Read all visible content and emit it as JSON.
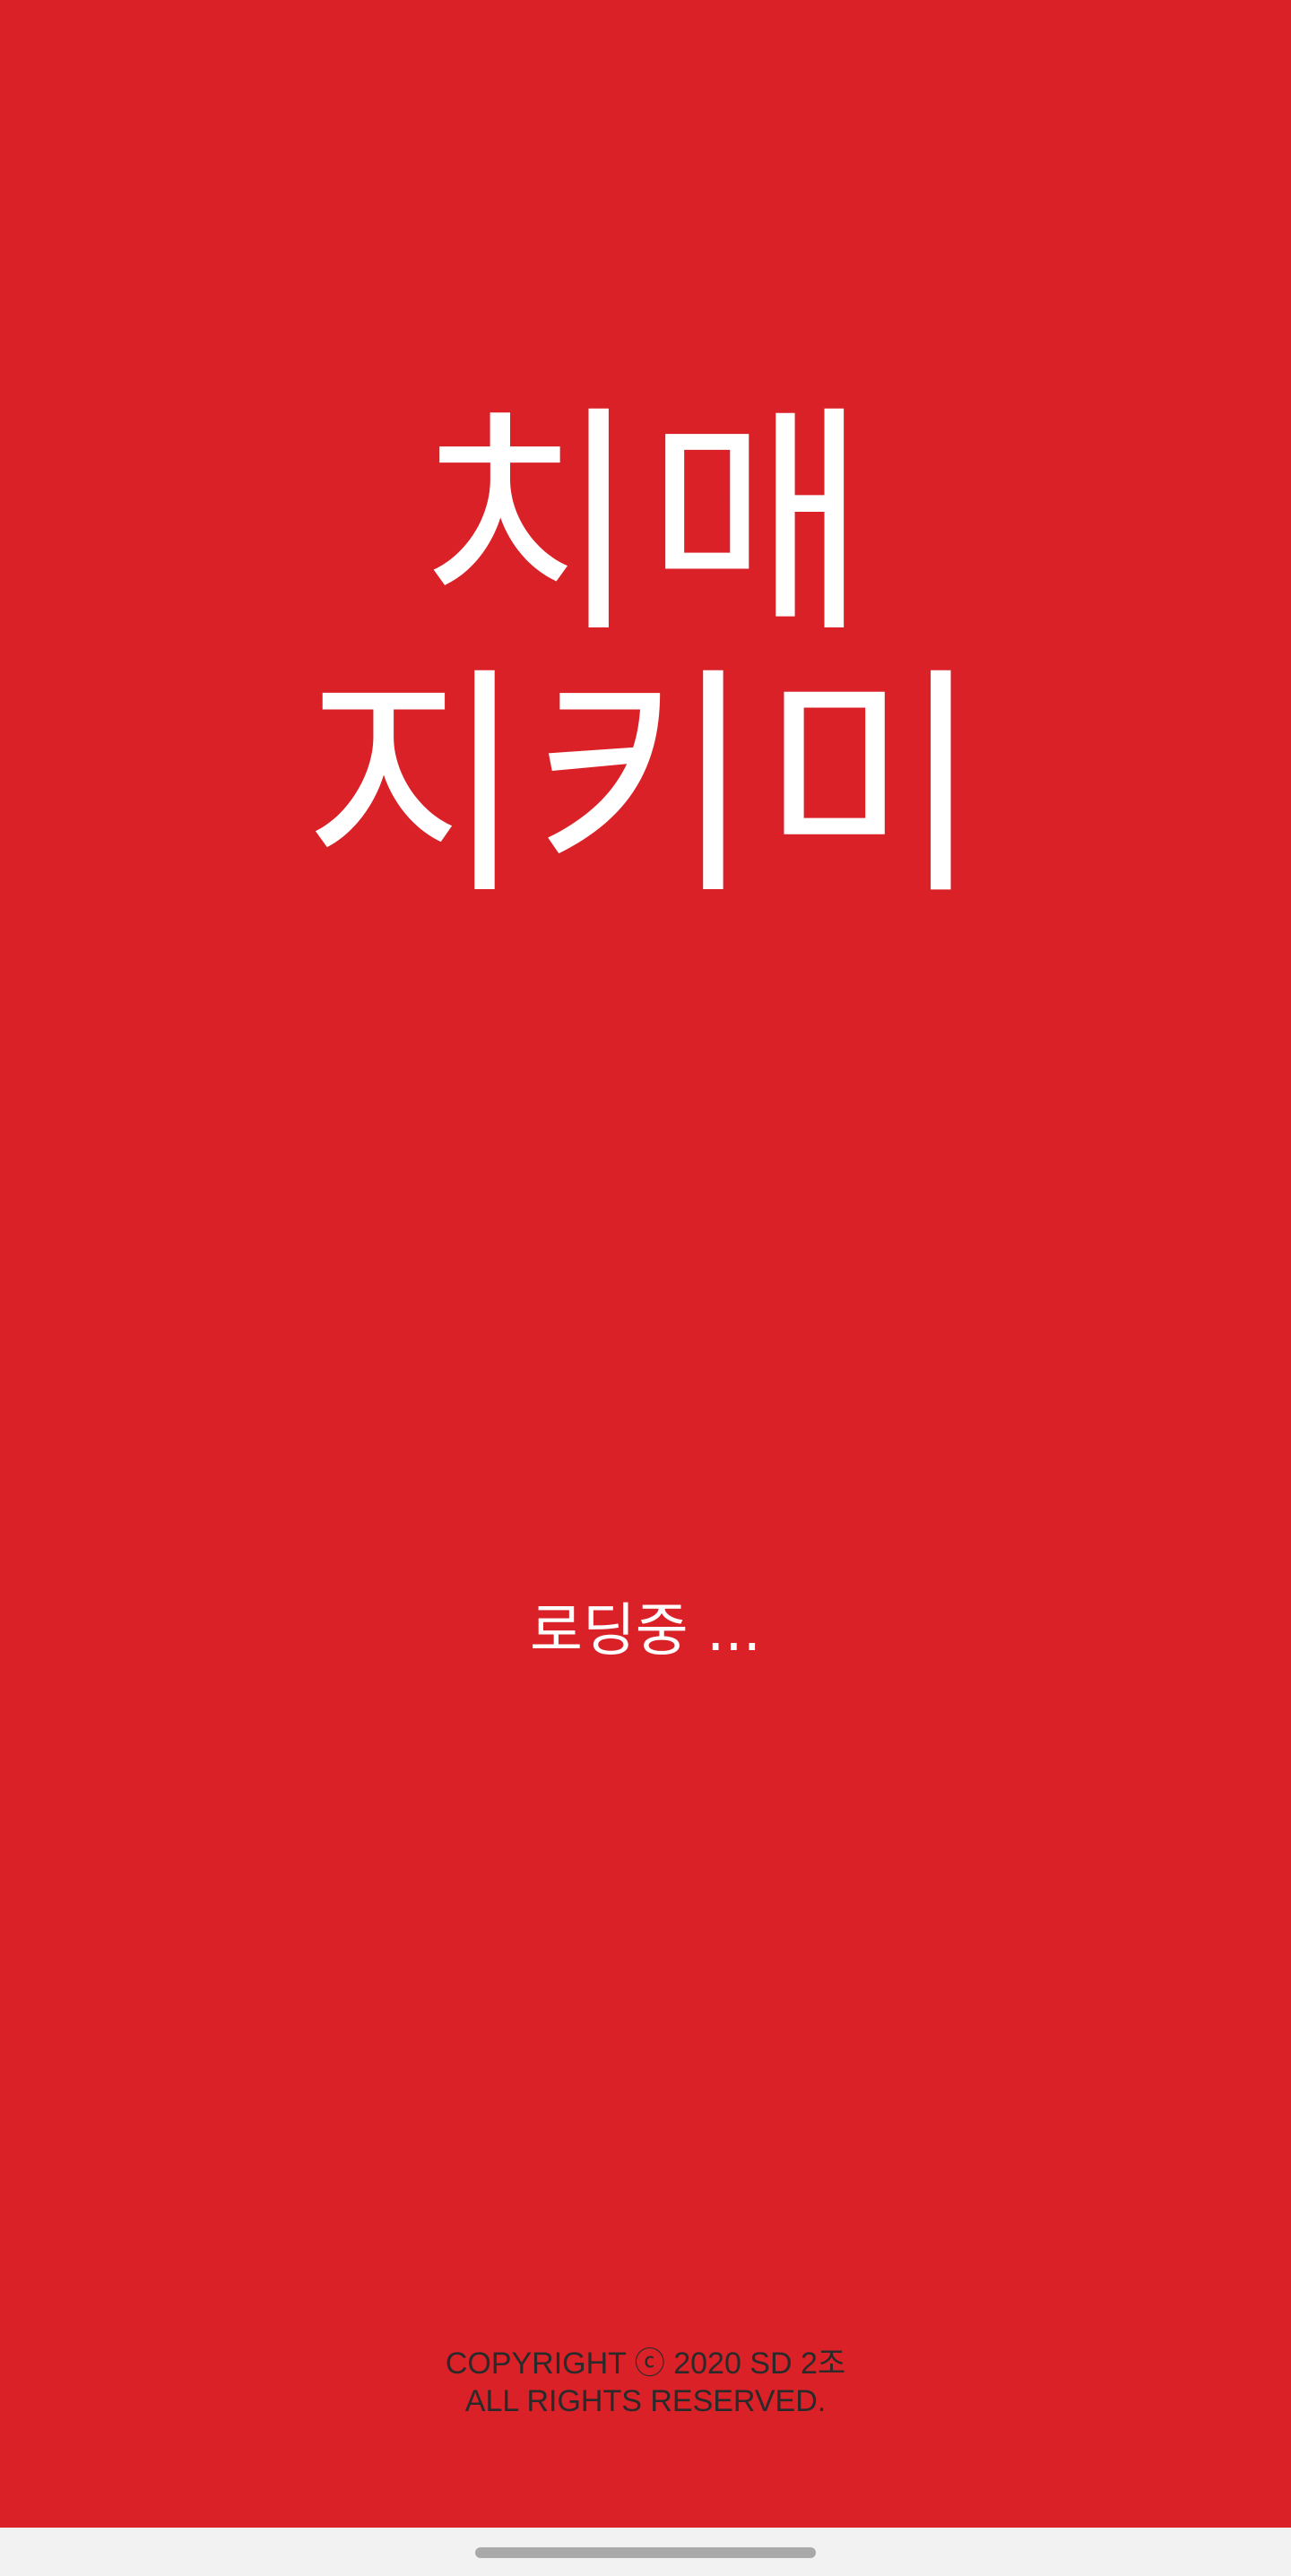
{
  "splash": {
    "logo_line1": "치매",
    "logo_line2": "지키미",
    "loading_text": "로딩중 ...",
    "copyright_line1": "COPYRIGHT ⓒ 2020 SD 2조",
    "copyright_line2": "ALL RIGHTS RESERVED."
  },
  "colors": {
    "background": "#d92127",
    "text": "#ffffff",
    "copyright_text": "#2a2a2a",
    "nav_bar": "#f2f2f2"
  },
  "icons": {
    "home_indicator": "home-indicator-icon"
  }
}
